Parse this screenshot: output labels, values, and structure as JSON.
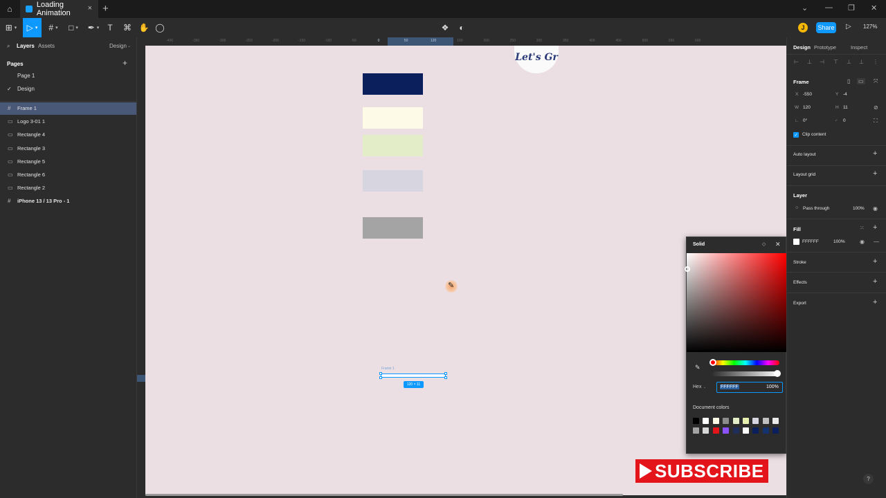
{
  "titlebar": {
    "home_icon": "home-icon",
    "tab_title": "Loading Animation",
    "tab_close": "×",
    "new_tab": "+",
    "win_minimize": "—",
    "win_restore": "❐",
    "win_close": "✕",
    "win_caret": "⌄"
  },
  "toolbar": {
    "main_menu": "⊞",
    "move_tool": "▷",
    "frame_tool": "#",
    "shape_tool": "□",
    "pen_tool": "✒",
    "text_tool": "T",
    "resource_tool": "⌘",
    "hand_tool": "✋",
    "comment_tool": "◯",
    "components_icon": "❖",
    "contrast_icon": "◐",
    "avatar_initial": "J",
    "share_label": "Share",
    "present_icon": "▷",
    "zoom_label": "127%"
  },
  "left_panel": {
    "tabs": [
      "Layers",
      "Assets",
      "Design"
    ],
    "pages_header": "Pages",
    "pages": [
      {
        "label": "Page 1",
        "current": false
      },
      {
        "label": "Design",
        "current": true
      }
    ],
    "layers": [
      {
        "icon": "#",
        "name": "Frame 1",
        "selected": true,
        "bold": false
      },
      {
        "icon": "▭",
        "name": "Logo 3-01 1",
        "selected": false,
        "bold": false
      },
      {
        "icon": "▭",
        "name": "Rectangle 4",
        "selected": false,
        "bold": false
      },
      {
        "icon": "▭",
        "name": "Rectangle 3",
        "selected": false,
        "bold": false
      },
      {
        "icon": "▭",
        "name": "Rectangle 5",
        "selected": false,
        "bold": false
      },
      {
        "icon": "▭",
        "name": "Rectangle 6",
        "selected": false,
        "bold": false
      },
      {
        "icon": "▭",
        "name": "Rectangle 2",
        "selected": false,
        "bold": false
      },
      {
        "icon": "#",
        "name": "iPhone 13 / 13 Pro - 1",
        "selected": false,
        "bold": true
      }
    ]
  },
  "canvas": {
    "ruler_ticks": [
      "-400",
      "-350",
      "-300",
      "-250",
      "-200",
      "-150",
      "-100",
      "-50",
      "0",
      "50",
      "120",
      "150",
      "200",
      "250",
      "300",
      "350",
      "400",
      "450",
      "500",
      "550",
      "600"
    ],
    "background": "#ebdfe3",
    "rect_colors": [
      "#0a1f5c",
      "#fdfbe8",
      "#e3edc8",
      "#d7d6e0",
      "#a4a4a4"
    ],
    "logo_text": "Let's Gr",
    "frame_label": "Frame 1",
    "frame_size": "120 × 11"
  },
  "subscribe": {
    "label": "SUBSCRIBE"
  },
  "color_picker": {
    "mode": "Solid",
    "style_icon": "◇",
    "close": "✕",
    "dropper_icon": "✎",
    "hex_label": "Hex",
    "hex_value": "FFFFFF",
    "opacity": "100%",
    "doc_colors_label": "Document colors",
    "swatches_row1": [
      "#000000",
      "#ffffff",
      "#fdfbe8",
      "#8c8c8c",
      "#e3edc8",
      "#e8f0b0",
      "#d7d6e0",
      "#c0c0c0",
      "#ebebeb"
    ],
    "swatches_row2": [
      "#a4a4a4",
      "#d8d8d8",
      "#e4141b",
      "#8c52ff",
      "#1f2d5a",
      "#ffffff",
      "#0a1f5c",
      "#14326e",
      "#0a1f5c"
    ]
  },
  "right_panel": {
    "tabs": [
      "Design",
      "Prototype",
      "Inspect"
    ],
    "frame_section": "Frame",
    "x_label": "X",
    "x_value": "-550",
    "y_label": "Y",
    "y_value": "-4",
    "w_label": "W",
    "w_value": "120",
    "h_label": "H",
    "h_value": "11",
    "rotation": "0°",
    "radius": "0",
    "clip_content": "Clip content",
    "auto_layout": "Auto layout",
    "layout_grid": "Layout grid",
    "layer_section": "Layer",
    "blend_mode": "Pass through",
    "layer_opacity": "100%",
    "fill_section": "Fill",
    "fill_hex": "FFFFFF",
    "fill_opacity": "100%",
    "stroke_section": "Stroke",
    "effects_section": "Effects",
    "export_section": "Export"
  },
  "help_label": "?"
}
